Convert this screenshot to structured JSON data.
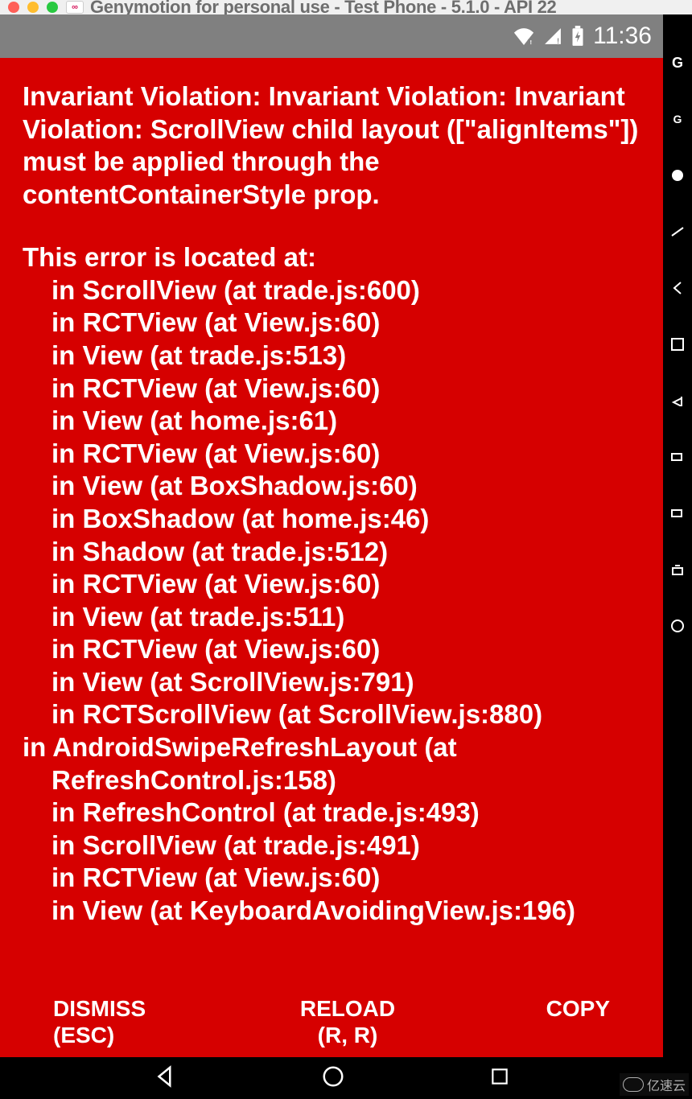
{
  "mac": {
    "title": "Genymotion for personal use - Test Phone - 5.1.0 - API 22"
  },
  "status_bar": {
    "time": "11:36"
  },
  "error": {
    "title": "Invariant Violation: Invariant Violation: Invariant Violation: ScrollView child layout ([\"alignItems\"]) must be applied through the contentContainerStyle prop.",
    "stack_header": "This error is located at:",
    "stack": [
      "in ScrollView (at trade.js:600)",
      "in RCTView (at View.js:60)",
      "in View (at trade.js:513)",
      "in RCTView (at View.js:60)",
      "in View (at home.js:61)",
      "in RCTView (at View.js:60)",
      "in View (at BoxShadow.js:60)",
      "in BoxShadow (at home.js:46)",
      "in Shadow (at trade.js:512)",
      "in RCTView (at View.js:60)",
      "in View (at trade.js:511)",
      "in RCTView (at View.js:60)",
      "in View (at ScrollView.js:791)",
      "in RCTScrollView (at ScrollView.js:880)",
      "in AndroidSwipeRefreshLayout (at RefreshControl.js:158)",
      "in RefreshControl (at trade.js:493)",
      "in ScrollView (at trade.js:491)",
      "in RCTView (at View.js:60)",
      "in View (at KeyboardAvoidingView.js:196)"
    ],
    "buttons": {
      "dismiss": "DISMISS\n(ESC)",
      "reload": "RELOAD\n(R, R)",
      "copy": "COPY"
    }
  },
  "side_toolbar": {
    "labels": [
      "G",
      "G"
    ]
  },
  "watermark": {
    "text": "亿速云"
  },
  "colors": {
    "error_bg": "#d60000",
    "error_fg": "#ffffff"
  }
}
